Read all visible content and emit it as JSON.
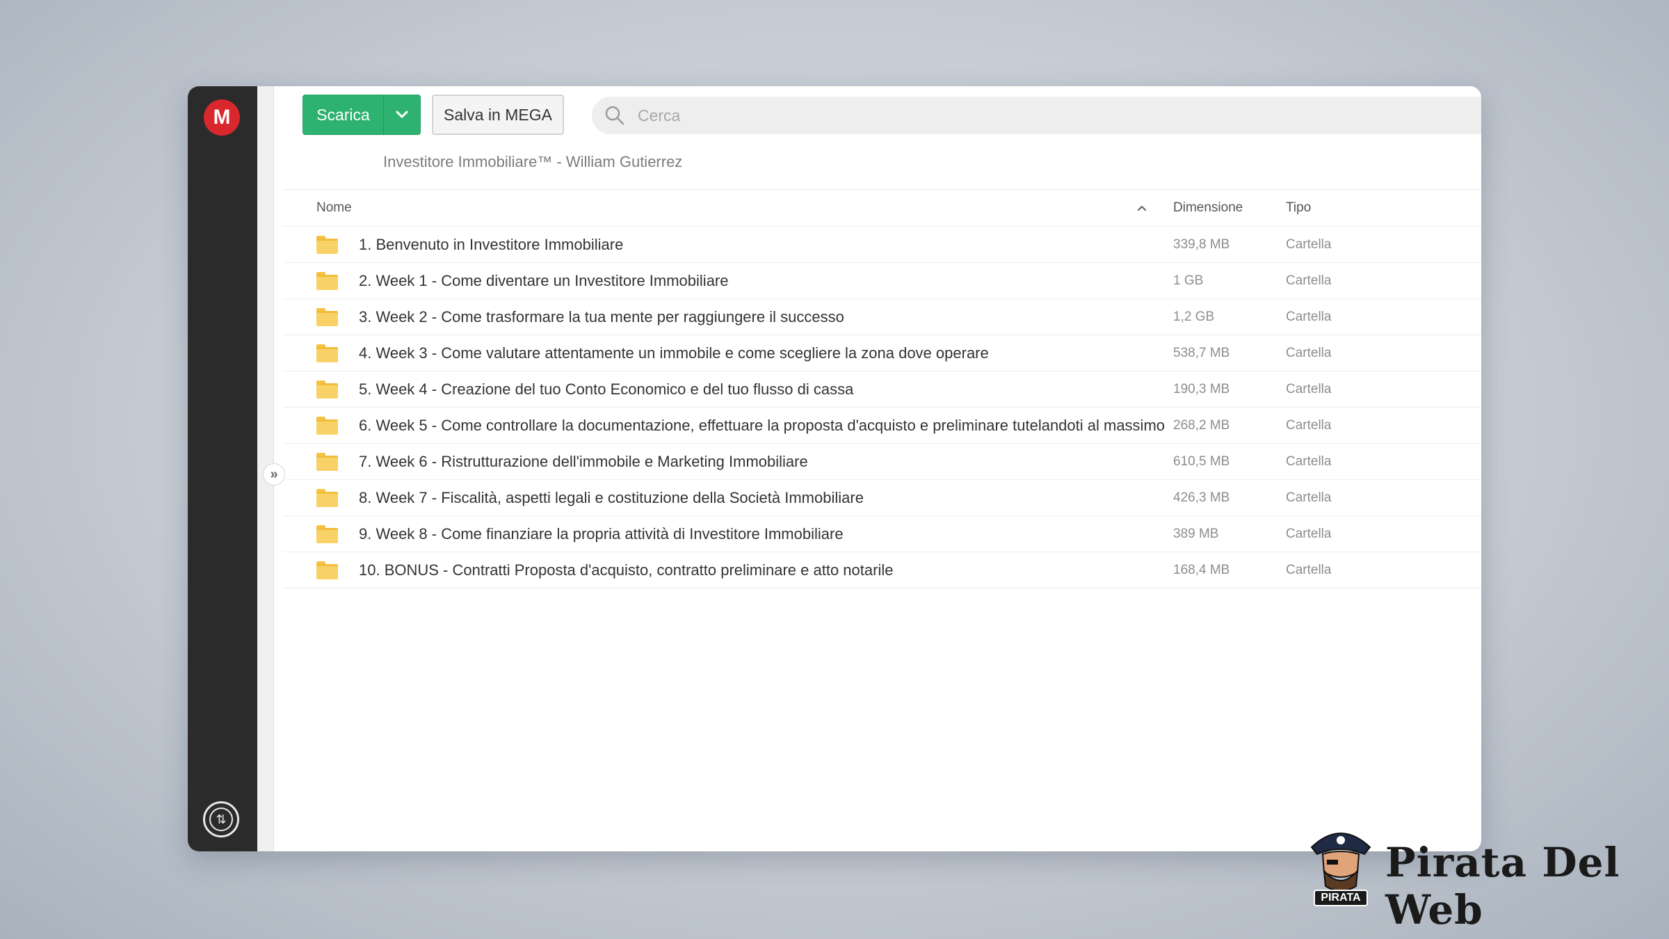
{
  "sidebar": {
    "logo_letter": "M",
    "expand_glyph": "»"
  },
  "toolbar": {
    "download_label": "Scarica",
    "save_label": "Salva in MEGA"
  },
  "search": {
    "placeholder": "Cerca"
  },
  "breadcrumb": "Investitore Immobiliare™ - William Gutierrez",
  "table": {
    "headers": {
      "name": "Nome",
      "size": "Dimensione",
      "type": "Tipo"
    },
    "sort_indicator": "up",
    "rows": [
      {
        "name": "1. Benvenuto in Investitore Immobiliare",
        "size": "339,8 MB",
        "type": "Cartella"
      },
      {
        "name": "2. Week 1 - Come diventare un Investitore Immobiliare",
        "size": "1 GB",
        "type": "Cartella"
      },
      {
        "name": "3. Week 2 - Come trasformare la tua mente per raggiungere il successo",
        "size": "1,2 GB",
        "type": "Cartella"
      },
      {
        "name": "4. Week 3 - Come valutare attentamente un immobile e come scegliere la zona dove operare",
        "size": "538,7 MB",
        "type": "Cartella"
      },
      {
        "name": "5. Week 4 - Creazione del tuo Conto Economico e del tuo flusso di cassa",
        "size": "190,3 MB",
        "type": "Cartella"
      },
      {
        "name": "6. Week 5 - Come controllare la documentazione, effettuare la proposta d'acquisto e preliminare tutelandoti al massimo",
        "size": "268,2 MB",
        "type": "Cartella"
      },
      {
        "name": "7. Week 6 - Ristrutturazione dell'immobile e Marketing Immobiliare",
        "size": "610,5 MB",
        "type": "Cartella"
      },
      {
        "name": "8. Week 7 - Fiscalità, aspetti legali e costituzione della Società Immobiliare",
        "size": "426,3 MB",
        "type": "Cartella"
      },
      {
        "name": "9. Week 8 - Come finanziare la propria attività di Investitore Immobiliare",
        "size": "389 MB",
        "type": "Cartella"
      },
      {
        "name": "10. BONUS - Contratti Proposta d'acquisto, contratto preliminare e atto notarile",
        "size": "168,4 MB",
        "type": "Cartella"
      }
    ]
  },
  "branding": {
    "badge_text": "PIRATA",
    "wordmark": "Pirata Del Web"
  },
  "colors": {
    "download_green": "#2db36f",
    "mega_red": "#d9272e",
    "folder_yellow": "#f8d266",
    "sidebar_dark": "#2b2b2b"
  },
  "icons": [
    "mega-logo-icon",
    "chevron-down-icon",
    "search-icon",
    "folder-icon",
    "expand-icon",
    "transfers-icon",
    "sort-asc-icon",
    "pirate-logo-icon"
  ]
}
